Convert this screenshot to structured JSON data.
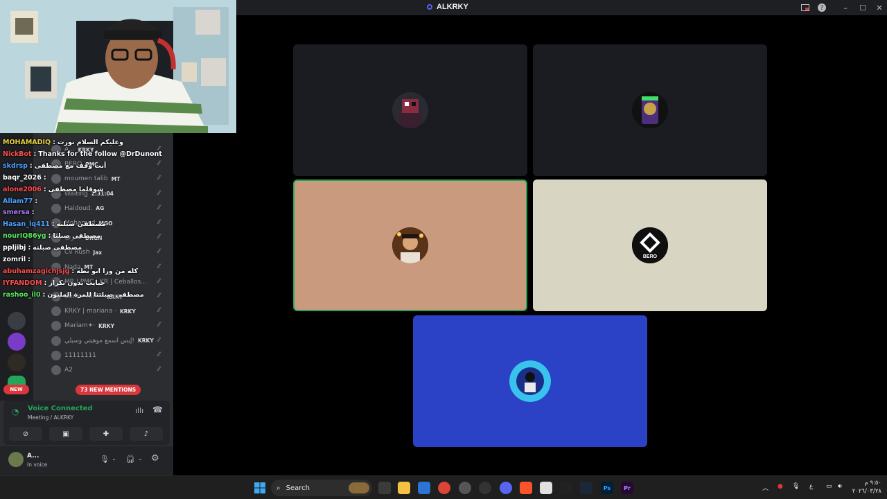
{
  "window": {
    "title": "ALKRKY"
  },
  "channel_list": [
    {
      "name": "A...",
      "tag": "KRKY"
    },
    {
      "name": "BERO",
      "tag": "PMC"
    },
    {
      "name": "moumen talib",
      "tag": "MT"
    },
    {
      "name": "Waiting",
      "tag": "2:31:04"
    },
    {
      "name": "Haidoud.",
      "tag": "AG"
    },
    {
      "name": "Mohamed",
      "tag": "MGO"
    },
    {
      "name": "محرف",
      "tag": "DRGN"
    },
    {
      "name": "Cv Rush",
      "tag": "Jax"
    },
    {
      "name": "Nada",
      "tag": "MT"
    },
    {
      "name": "MR | PMC | KR | Ceballos...",
      "tag": ""
    },
    {
      "name": "Senior Ali ⁰⁰⁰",
      "tag": "KRKY"
    },
    {
      "name": "KRKY | mariana ·",
      "tag": "KRKY"
    },
    {
      "name": "Mariam✦·",
      "tag": "KRKY"
    },
    {
      "name": "إيس اسمع موهيتي وسيلي!",
      "tag": "KRKY"
    },
    {
      "name": "11111111",
      "tag": ""
    },
    {
      "name": "A2",
      "tag": ""
    }
  ],
  "chat": [
    {
      "user": "MOHAMADIQ",
      "text": "وعليكم السلام نورت",
      "color": "#e8d33f"
    },
    {
      "user": "NickBot",
      "text": "Thanks for the follow @DrDunont",
      "color": "#ff4d4d"
    },
    {
      "user": "skdrsp",
      "text": "أنت وقف مع مصطفى",
      "color": "#4ea1ff"
    },
    {
      "user": "baqr_2026",
      "text": "",
      "color": "#ffffff"
    },
    {
      "user": "alone2006",
      "text": "شوقلما مصطفى",
      "color": "#ff4d4d"
    },
    {
      "user": "Allam77",
      "text": "",
      "color": "#4ea1ff"
    },
    {
      "user": "smersa",
      "text": "",
      "color": "#b07cff"
    },
    {
      "user": "Hasan_lq411",
      "text": "مصطفى صبلته",
      "color": "#4ea1ff"
    },
    {
      "user": "nourIQ86yg",
      "text": "مصطفى صبلنا",
      "color": "#5ce65c"
    },
    {
      "user": "ppljibj",
      "text": "مصطفى صبلته",
      "color": "#ffffff"
    },
    {
      "user": "zomril",
      "text": "",
      "color": "#ffffff"
    },
    {
      "user": "abuhamzagichjsjg",
      "text": "كله من ورا ابو نطه",
      "color": "#ff4d4d"
    },
    {
      "user": "IYFANDOM",
      "text": "حبايب بدون تكرار",
      "color": "#ff4d4d"
    },
    {
      "user": "rashoo_il0",
      "text": "مصطفى صبلتنا للمرة المليون",
      "color": "#5ce65c"
    }
  ],
  "badges": {
    "new": "NEW",
    "mentions": "73 NEW MENTIONS"
  },
  "voice": {
    "status": "Voice Connected",
    "channel": "Meeting / ALKRKY"
  },
  "user": {
    "name": "A...",
    "status": "In voice"
  },
  "taskbar": {
    "search": "Search",
    "time": "٩:٥٠ م",
    "date": "٢٠٢٦/٠٣/٢٨",
    "lang": "ع"
  },
  "colors": {
    "tile_dark": "#1b1c22",
    "tile_tan": "#c99a7e",
    "tile_cream": "#d8d6c2",
    "tile_blue": "#2b41c6",
    "speaking": "#23a55a"
  }
}
